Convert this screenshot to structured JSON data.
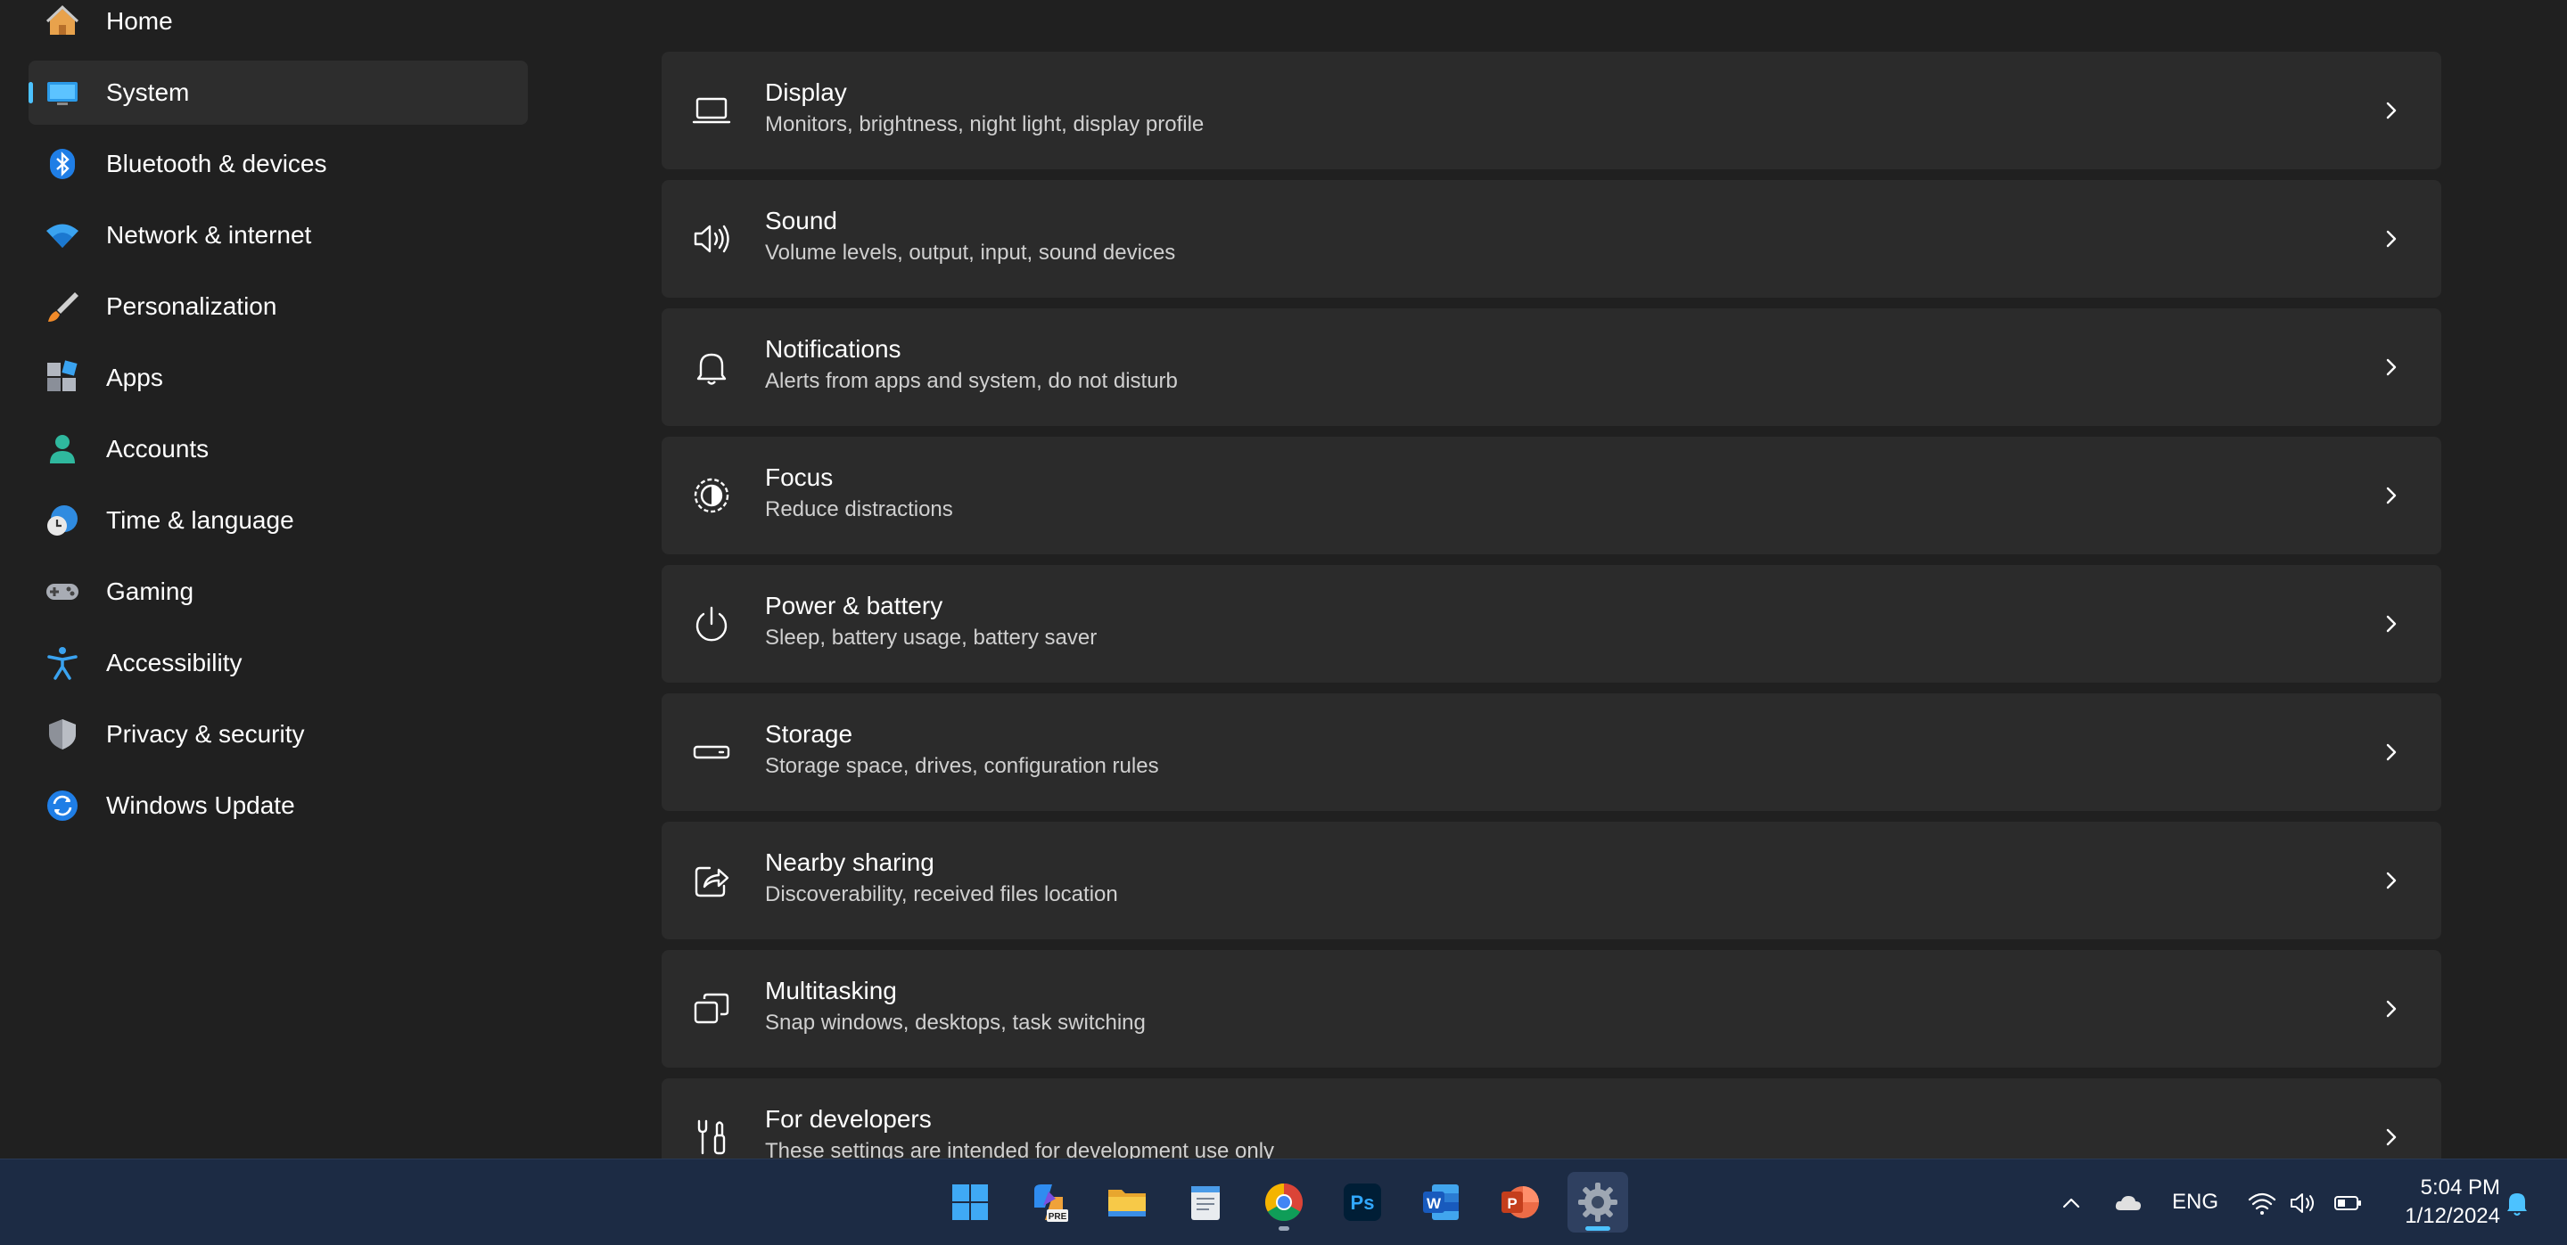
{
  "sidebar": {
    "items": [
      {
        "label": "Home",
        "icon": "home-icon",
        "selected": false
      },
      {
        "label": "System",
        "icon": "system-icon",
        "selected": true
      },
      {
        "label": "Bluetooth & devices",
        "icon": "bluetooth-icon",
        "selected": false
      },
      {
        "label": "Network & internet",
        "icon": "wifi-icon",
        "selected": false
      },
      {
        "label": "Personalization",
        "icon": "brush-icon",
        "selected": false
      },
      {
        "label": "Apps",
        "icon": "apps-icon",
        "selected": false
      },
      {
        "label": "Accounts",
        "icon": "person-icon",
        "selected": false
      },
      {
        "label": "Time & language",
        "icon": "globe-clock-icon",
        "selected": false
      },
      {
        "label": "Gaming",
        "icon": "gamepad-icon",
        "selected": false
      },
      {
        "label": "Accessibility",
        "icon": "accessibility-icon",
        "selected": false
      },
      {
        "label": "Privacy & security",
        "icon": "shield-icon",
        "selected": false
      },
      {
        "label": "Windows Update",
        "icon": "update-icon",
        "selected": false
      }
    ]
  },
  "main": {
    "cards": [
      {
        "title": "Display",
        "subtitle": "Monitors, brightness, night light, display profile",
        "icon": "display-icon"
      },
      {
        "title": "Sound",
        "subtitle": "Volume levels, output, input, sound devices",
        "icon": "speaker-icon"
      },
      {
        "title": "Notifications",
        "subtitle": "Alerts from apps and system, do not disturb",
        "icon": "bell-icon"
      },
      {
        "title": "Focus",
        "subtitle": "Reduce distractions",
        "icon": "focus-icon"
      },
      {
        "title": "Power & battery",
        "subtitle": "Sleep, battery usage, battery saver",
        "icon": "power-icon"
      },
      {
        "title": "Storage",
        "subtitle": "Storage space, drives, configuration rules",
        "icon": "storage-icon"
      },
      {
        "title": "Nearby sharing",
        "subtitle": "Discoverability, received files location",
        "icon": "share-icon"
      },
      {
        "title": "Multitasking",
        "subtitle": "Snap windows, desktops, task switching",
        "icon": "multitask-icon"
      },
      {
        "title": "For developers",
        "subtitle": "These settings are intended for development use only",
        "icon": "developer-tools-icon"
      }
    ]
  },
  "taskbar": {
    "apps": [
      {
        "name": "start",
        "icon": "windows-logo-icon",
        "active": false,
        "running": false
      },
      {
        "name": "copilot",
        "icon": "copilot-icon",
        "badge": "PRE",
        "active": false,
        "running": false
      },
      {
        "name": "file-explorer",
        "icon": "folder-icon",
        "active": false,
        "running": false
      },
      {
        "name": "notepad",
        "icon": "notepad-icon",
        "active": false,
        "running": false
      },
      {
        "name": "chrome",
        "icon": "chrome-icon",
        "active": false,
        "running": true
      },
      {
        "name": "photoshop",
        "icon": "photoshop-icon",
        "label": "Ps",
        "active": false,
        "running": false
      },
      {
        "name": "word",
        "icon": "word-icon",
        "label": "W",
        "active": false,
        "running": false
      },
      {
        "name": "powerpoint",
        "icon": "powerpoint-icon",
        "label": "P",
        "active": false,
        "running": false
      },
      {
        "name": "settings",
        "icon": "gear-icon",
        "active": true,
        "running": true
      }
    ],
    "tray": {
      "language": "ENG",
      "time": "5:04 PM",
      "date": "1/12/2024"
    }
  },
  "colors": {
    "background": "#202020",
    "card": "#2b2b2b",
    "selected": "#2d2d2d",
    "accent": "#4cc2ff",
    "taskbar": "#1c2b44"
  }
}
